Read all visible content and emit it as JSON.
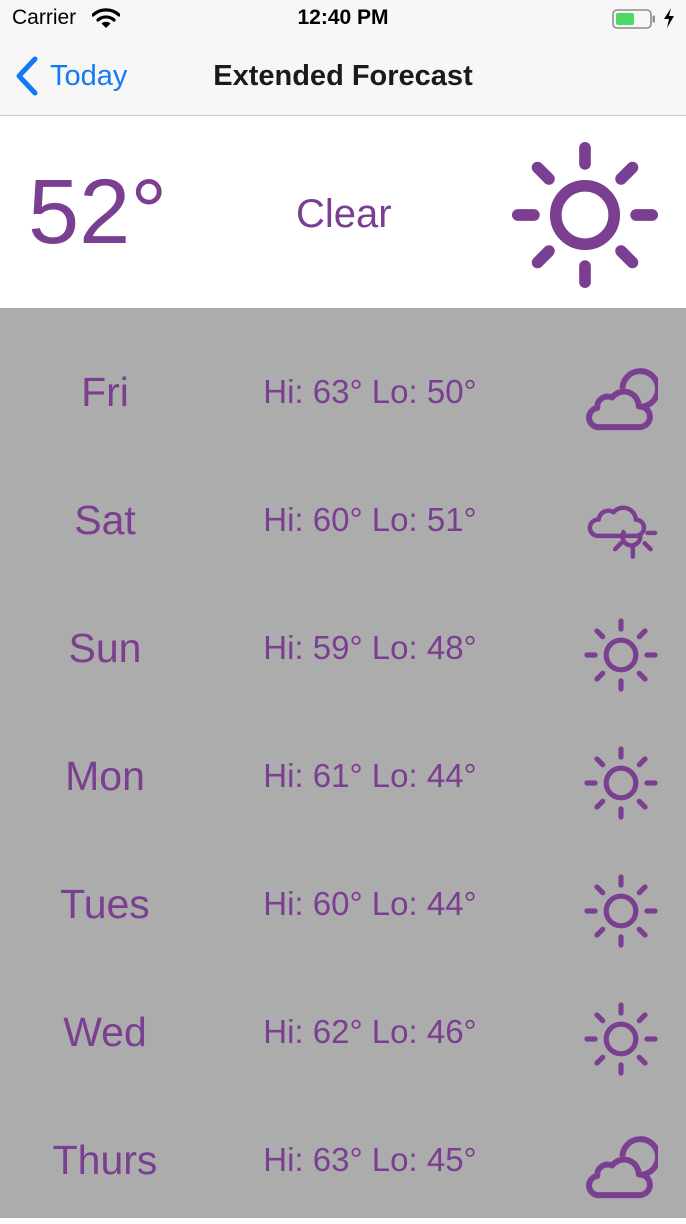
{
  "status_bar": {
    "carrier": "Carrier",
    "time": "12:40 PM"
  },
  "nav": {
    "back_label": "Today",
    "title": "Extended Forecast"
  },
  "current": {
    "temperature": "52°",
    "condition": "Clear",
    "icon": "sun-icon"
  },
  "forecast": [
    {
      "day": "Fri",
      "hilo": "Hi: 63° Lo: 50°",
      "icon": "sun-behind-cloud-icon"
    },
    {
      "day": "Sat",
      "hilo": "Hi: 60° Lo: 51°",
      "icon": "partly-cloudy-icon"
    },
    {
      "day": "Sun",
      "hilo": "Hi: 59° Lo: 48°",
      "icon": "sun-icon"
    },
    {
      "day": "Mon",
      "hilo": "Hi: 61° Lo: 44°",
      "icon": "sun-icon"
    },
    {
      "day": "Tues",
      "hilo": "Hi: 60° Lo: 44°",
      "icon": "sun-icon"
    },
    {
      "day": "Wed",
      "hilo": "Hi: 62° Lo: 46°",
      "icon": "sun-icon"
    },
    {
      "day": "Thurs",
      "hilo": "Hi: 63° Lo: 45°",
      "icon": "sun-behind-cloud-icon"
    }
  ],
  "colors": {
    "accent": "#7b3f91",
    "link": "#1479f6",
    "list_background": "#acacac",
    "battery": "#4cd964"
  }
}
